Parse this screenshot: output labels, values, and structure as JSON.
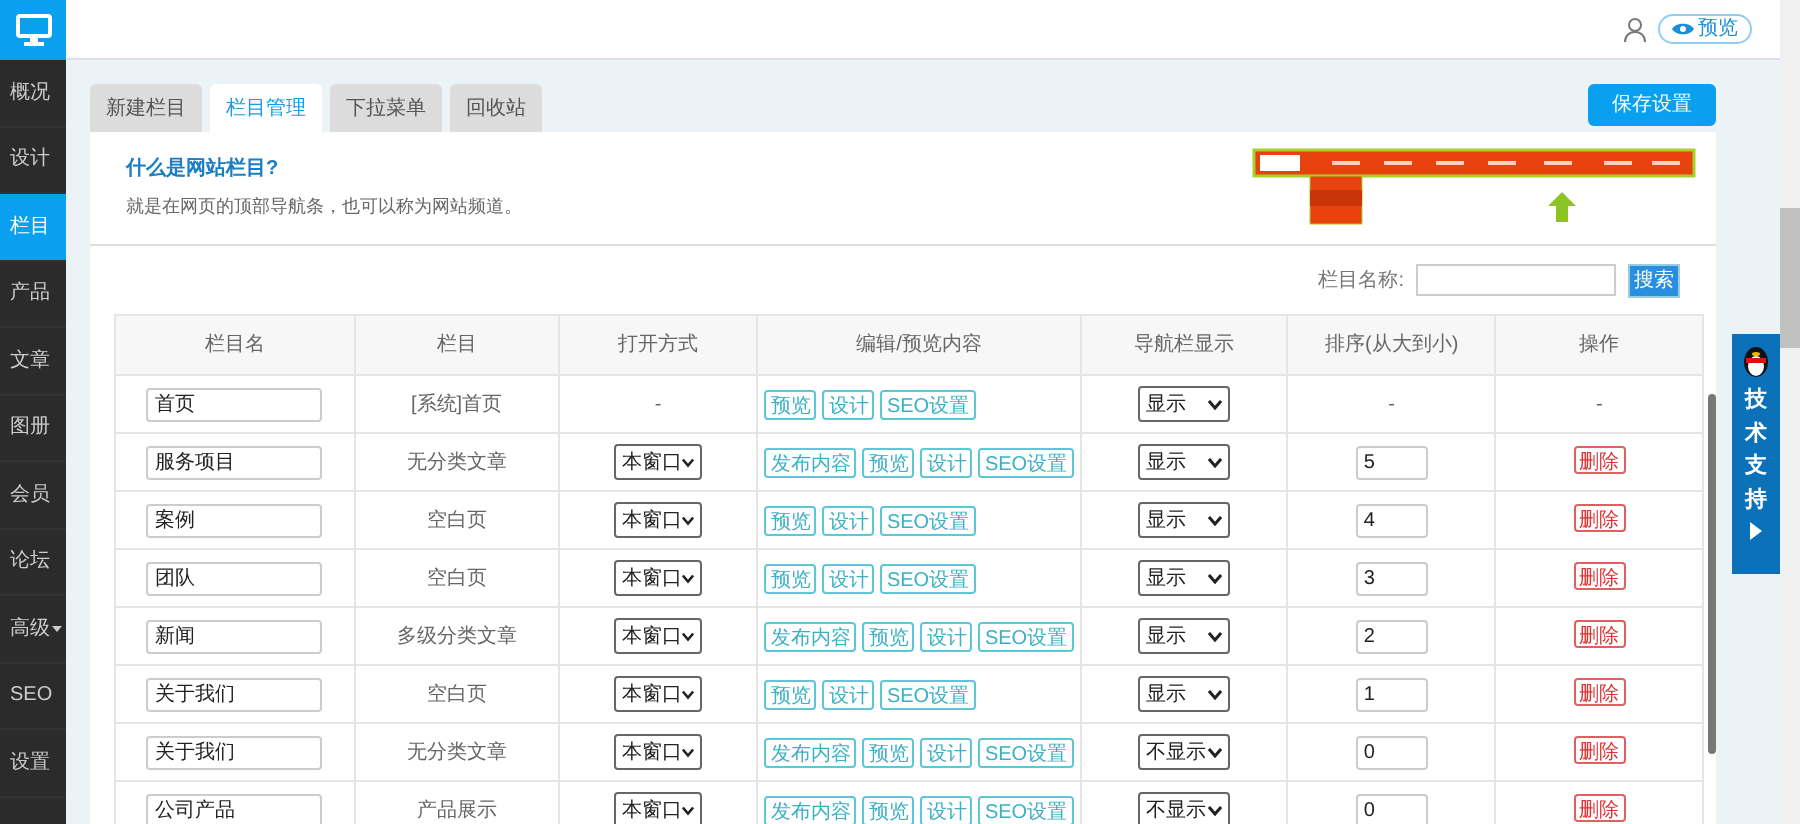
{
  "sidebar": {
    "items": [
      {
        "label": "概况",
        "selected": false,
        "has_caret": false
      },
      {
        "label": "设计",
        "selected": false,
        "has_caret": false
      },
      {
        "label": "栏目",
        "selected": true,
        "has_caret": false
      },
      {
        "label": "产品",
        "selected": false,
        "has_caret": false
      },
      {
        "label": "文章",
        "selected": false,
        "has_caret": false
      },
      {
        "label": "图册",
        "selected": false,
        "has_caret": false
      },
      {
        "label": "会员",
        "selected": false,
        "has_caret": false
      },
      {
        "label": "论坛",
        "selected": false,
        "has_caret": false
      },
      {
        "label": "高级",
        "selected": false,
        "has_caret": true
      },
      {
        "label": "SEO",
        "selected": false,
        "has_caret": false
      },
      {
        "label": "设置",
        "selected": false,
        "has_caret": false
      }
    ]
  },
  "header": {
    "preview_button": "预览"
  },
  "tabs": [
    {
      "label": "新建栏目",
      "selected": false
    },
    {
      "label": "栏目管理",
      "selected": true
    },
    {
      "label": "下拉菜单",
      "selected": false
    },
    {
      "label": "回收站",
      "selected": false
    }
  ],
  "save_button": "保存设置",
  "info": {
    "title": "什么是网站栏目?",
    "description": "就是在网页的顶部导航条，也可以称为网站频道。"
  },
  "search": {
    "label": "栏目名称:",
    "button": "搜索"
  },
  "table": {
    "columns": [
      "栏目名",
      "栏目",
      "打开方式",
      "编辑/预览内容",
      "导航栏显示",
      "排序(从大到小)",
      "操作"
    ],
    "rows": [
      {
        "name": "首页",
        "type": "[系统]首页",
        "open": {
          "kind": "text",
          "value": "-"
        },
        "actions": [
          "预览",
          "设计",
          "SEO设置"
        ],
        "nav": "显示",
        "sort": {
          "kind": "text",
          "value": "-"
        },
        "delete": {
          "kind": "text",
          "value": "-"
        }
      },
      {
        "name": "服务项目",
        "type": "无分类文章",
        "open": {
          "kind": "select",
          "value": "本窗口"
        },
        "actions": [
          "发布内容",
          "预览",
          "设计",
          "SEO设置"
        ],
        "nav": "显示",
        "sort": {
          "kind": "field",
          "value": "5"
        },
        "delete": {
          "kind": "button",
          "value": "删除"
        }
      },
      {
        "name": "案例",
        "type": "空白页",
        "open": {
          "kind": "select",
          "value": "本窗口"
        },
        "actions": [
          "预览",
          "设计",
          "SEO设置"
        ],
        "nav": "显示",
        "sort": {
          "kind": "field",
          "value": "4"
        },
        "delete": {
          "kind": "button",
          "value": "删除"
        }
      },
      {
        "name": "团队",
        "type": "空白页",
        "open": {
          "kind": "select",
          "value": "本窗口"
        },
        "actions": [
          "预览",
          "设计",
          "SEO设置"
        ],
        "nav": "显示",
        "sort": {
          "kind": "field",
          "value": "3"
        },
        "delete": {
          "kind": "button",
          "value": "删除"
        }
      },
      {
        "name": "新闻",
        "type": "多级分类文章",
        "open": {
          "kind": "select",
          "value": "本窗口"
        },
        "actions": [
          "发布内容",
          "预览",
          "设计",
          "SEO设置"
        ],
        "nav": "显示",
        "sort": {
          "kind": "field",
          "value": "2"
        },
        "delete": {
          "kind": "button",
          "value": "删除"
        }
      },
      {
        "name": "关于我们",
        "type": "空白页",
        "open": {
          "kind": "select",
          "value": "本窗口"
        },
        "actions": [
          "预览",
          "设计",
          "SEO设置"
        ],
        "nav": "显示",
        "sort": {
          "kind": "field",
          "value": "1"
        },
        "delete": {
          "kind": "button",
          "value": "删除"
        }
      },
      {
        "name": "关于我们",
        "type": "无分类文章",
        "open": {
          "kind": "select",
          "value": "本窗口"
        },
        "actions": [
          "发布内容",
          "预览",
          "设计",
          "SEO设置"
        ],
        "nav": "不显示",
        "sort": {
          "kind": "field",
          "value": "0"
        },
        "delete": {
          "kind": "button",
          "value": "删除"
        }
      },
      {
        "name": "公司产品",
        "type": "产品展示",
        "open": {
          "kind": "select",
          "value": "本窗口"
        },
        "actions": [
          "发布内容",
          "预览",
          "设计",
          "SEO设置"
        ],
        "nav": "不显示",
        "sort": {
          "kind": "field",
          "value": "0"
        },
        "delete": {
          "kind": "button",
          "value": "删除"
        }
      }
    ]
  },
  "support_widget": {
    "label": "技术支持"
  }
}
